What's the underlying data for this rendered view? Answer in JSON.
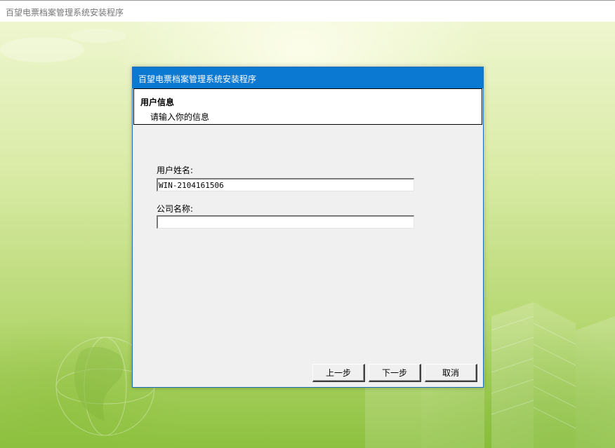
{
  "app": {
    "window_title": "百望电票档案管理系统安装程序"
  },
  "dialog": {
    "title": "百望电票档案管理系统安装程序",
    "header": {
      "title": "用户信息",
      "subtitle": "请输入你的信息"
    },
    "form": {
      "username_label": "用户姓名:",
      "username_value": "WIN-2104161506",
      "company_label": "公司名称:",
      "company_value": ""
    },
    "buttons": {
      "back": "上一步",
      "next": "下一步",
      "cancel": "取消"
    }
  },
  "colors": {
    "dialog_title_bar": "#0b78d2",
    "backdrop_light": "#eef6cf",
    "backdrop_dark": "#8dc13f",
    "dialog_body": "#f0f0f0"
  }
}
